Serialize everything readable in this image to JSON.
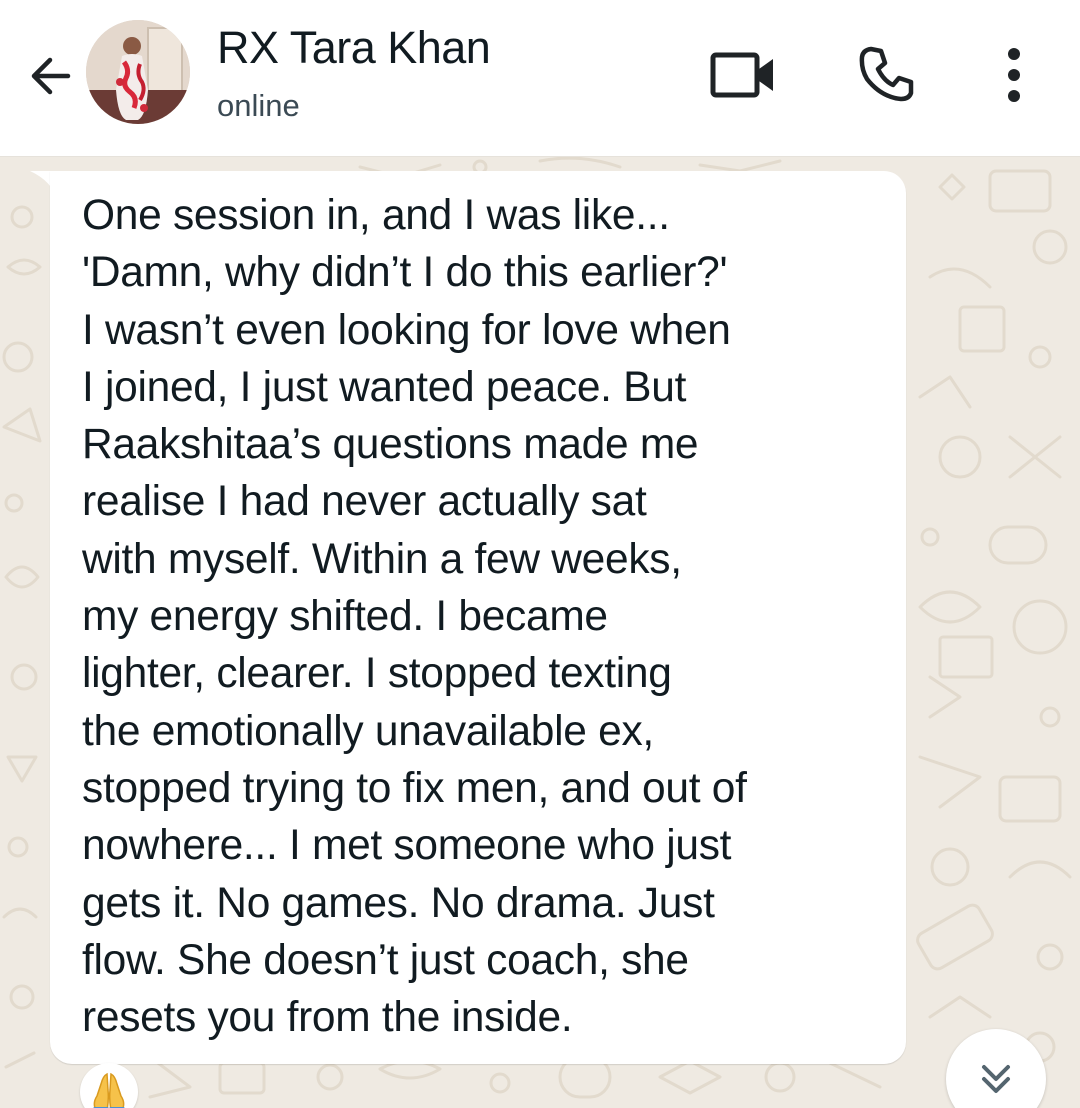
{
  "header": {
    "contact_name": "RX Tara Khan",
    "status": "online",
    "icons": {
      "back": "arrow-left-icon",
      "video": "video-camera-icon",
      "call": "phone-icon",
      "menu": "more-vertical-icon"
    }
  },
  "message": {
    "text": "One session in, and I was like...\n'Damn, why didn’t I do this earlier?'\nI wasn’t even looking for love when\nI joined, I just wanted peace. But\nRaakshitaa’s questions made me\nrealise I had never actually sat\nwith myself. Within a few weeks,\nmy energy shifted. I became\nlighter, clearer. I stopped texting\nthe emotionally unavailable ex,\nstopped trying to fix men, and out of\nnowhere... I met someone who just\ngets it. No games. No drama. Just\nflow. She doesn’t just coach, she\nresets you from the inside.",
    "time": "",
    "reaction": "🙏"
  },
  "colors": {
    "chat_background": "#efeae2",
    "wallpaper_doodle": "#e2dacd",
    "bubble": "#ffffff",
    "text_primary": "#111b21",
    "text_secondary": "#3b4a54"
  },
  "scroll_button": {
    "icon": "double-chevron-down-icon"
  }
}
